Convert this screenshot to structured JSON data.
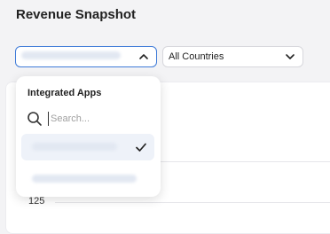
{
  "page": {
    "title": "Revenue Snapshot"
  },
  "filters": {
    "apps_select": {
      "value": ""
    },
    "countries_select": {
      "value": "All Countries"
    }
  },
  "dropdown": {
    "header": "Integrated Apps",
    "search_placeholder": "Search...",
    "options": [
      {
        "label": "",
        "selected": true
      },
      {
        "label": "",
        "selected": false
      }
    ]
  },
  "chart": {
    "y_tick_label": "125"
  },
  "icons": {
    "chevron_up": "chevron-up-icon",
    "chevron_down": "chevron-down-icon",
    "search": "search-icon",
    "check": "check-icon"
  },
  "colors": {
    "accent": "#3f7bd8",
    "selected_bg": "#eef2f9"
  }
}
